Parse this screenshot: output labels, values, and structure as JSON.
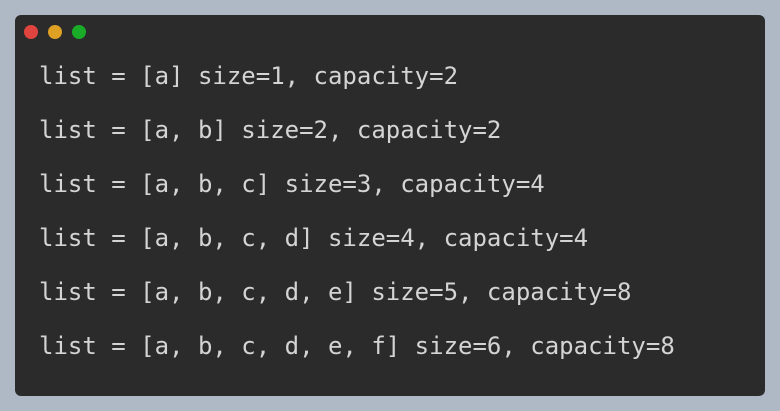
{
  "window": {
    "controls": [
      "close",
      "minimize",
      "maximize"
    ],
    "colors": {
      "background": "#2b2b2b",
      "page_background": "#aeb9c5",
      "text": "#d4d4d4",
      "close": "#e0443e",
      "minimize": "#dea123",
      "maximize": "#1aab29"
    }
  },
  "code": {
    "lines": [
      "list = [a] size=1, capacity=2",
      "list = [a, b] size=2, capacity=2",
      "list = [a, b, c] size=3, capacity=4",
      "list = [a, b, c, d] size=4, capacity=4",
      "list = [a, b, c, d, e] size=5, capacity=8",
      "list = [a, b, c, d, e, f] size=6, capacity=8"
    ]
  }
}
